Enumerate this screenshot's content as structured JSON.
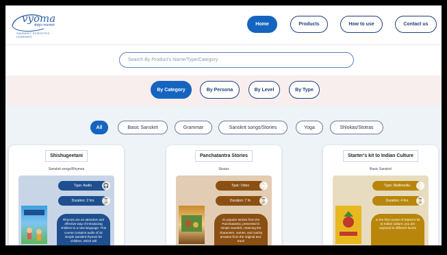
{
  "brand": {
    "name": "vyoma",
    "subtitle": "संस्कृत पाठशाला",
    "tagline": "SANSKRIT SCIENTIFIC LEARNING"
  },
  "nav": {
    "items": [
      "Home",
      "Products",
      "How to use",
      "Contact us"
    ],
    "active": "Home"
  },
  "search": {
    "placeholder": "Search By Product's Name/Type/Category"
  },
  "category_tabs": {
    "items": [
      "By Category",
      "By Persona",
      "By Level",
      "By Type"
    ],
    "active": "By Category"
  },
  "filters": {
    "items": [
      "All",
      "Basic Sanskrit",
      "Grammar",
      "Sanskrit songs/Stories",
      "Yoga",
      "Shlokas/Stotras"
    ],
    "active": "All"
  },
  "cards": [
    {
      "title": "Shishugeetani",
      "category": "Sanskrit songs/Rhymes",
      "type": "Type: Audio",
      "duration": "Duration: 2 hrs",
      "description": "Rhymes are an attractive and effective way of introducing children to a new language. This course contains audio of 31 simple Sanskrit rhymes for children, which will",
      "accent": "#1f4f8f",
      "image_bg": "#c7d5e6"
    },
    {
      "title": "Panchatantra Stories",
      "category": "Stories",
      "type": "Type: Video",
      "duration": "Duration: 7 hr",
      "description": "21 popular stories from the Panchatantra, presented in simple Sanskrit, retaining the characters, names, and catchy phrases from the original text. Each",
      "accent": "#8a4f12",
      "image_bg": "#e2ccb3"
    },
    {
      "title": "Starter's kit to Indian Culture",
      "category": "Basic Sanskrit",
      "type": "Type: Multimedia",
      "duration": "Duration: 4 hrs",
      "description": "In the first course of Starter's kit to Indian culture, you are exposed to different facets",
      "accent": "#b8860b",
      "image_bg": "#e8dcc0"
    }
  ]
}
